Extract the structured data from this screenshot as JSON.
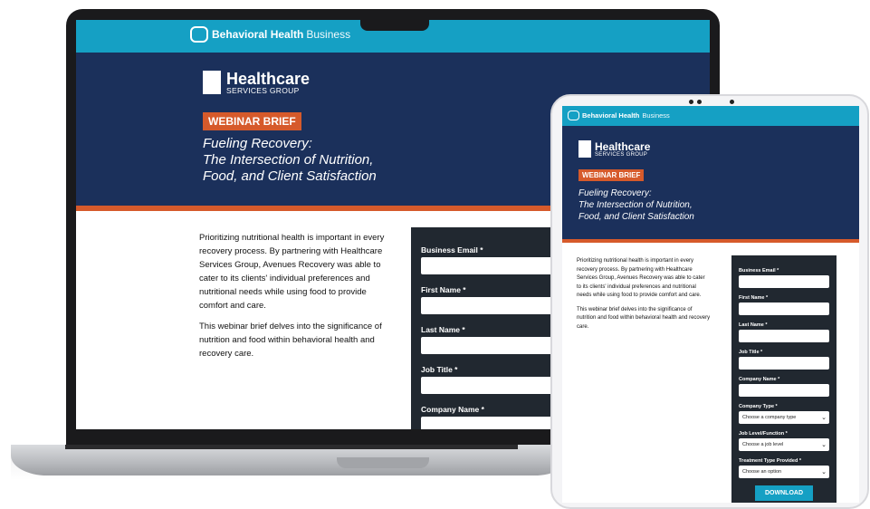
{
  "brand": {
    "bhb_bold": "Behavioral Health",
    "bhb_light": "Business",
    "hsg_line1": "Healthcare",
    "hsg_line2": "SERVICES GROUP"
  },
  "badge": "WEBINAR BRIEF",
  "title": {
    "line1": "Fueling Recovery:",
    "line2": "The Intersection of Nutrition,",
    "line3": "Food, and Client Satisfaction"
  },
  "body": {
    "p1": "Prioritizing nutritional health is important in every recovery process. By partnering with Healthcare Services Group, Avenues Recovery was able to cater to its clients' individual preferences and nutritional needs while using food to provide comfort and care.",
    "p2": "This webinar brief delves into the significance of nutrition and food within behavioral health and recovery care."
  },
  "form": {
    "business_email": "Business Email *",
    "first_name": "First Name *",
    "last_name": "Last Name *",
    "job_title": "Job Title *",
    "company_name": "Company Name *",
    "company_type": "Company Type *",
    "company_type_value": "Choose a company type",
    "job_level": "Job Level/Function *",
    "job_level_value": "Choose a job level",
    "treatment_type": "Treatment Type Provided *",
    "treatment_type_value": "Choose an option",
    "download": "DOWNLOAD"
  },
  "colors": {
    "teal": "#15a0c4",
    "navy": "#1b305b",
    "orange": "#d65a2b",
    "form_bg": "#212830"
  }
}
